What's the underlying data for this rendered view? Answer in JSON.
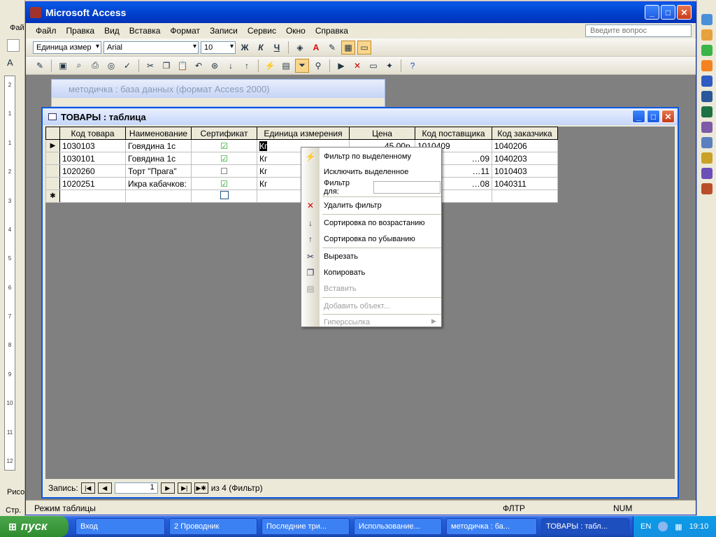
{
  "access": {
    "title": "Microsoft Access",
    "menu": [
      "Файл",
      "Правка",
      "Вид",
      "Вставка",
      "Формат",
      "Записи",
      "Сервис",
      "Окно",
      "Справка"
    ],
    "ask_placeholder": "Введите вопрос",
    "field_combo": "Единица измер",
    "font_combo": "Arial",
    "size_combo": "10"
  },
  "db_window": {
    "title": "методичка : база данных (формат Access 2000)"
  },
  "table_window": {
    "title": "ТОВАРЫ : таблица",
    "columns": [
      "Код товара",
      "Наименование",
      "Сертификат",
      "Единица измерения",
      "Цена",
      "Код поставщика",
      "Код заказчика"
    ],
    "rows": [
      [
        "1030103",
        "Говядина 1с",
        "☑",
        "Кг",
        "45,00р.",
        "1010409",
        "1040206"
      ],
      [
        "1030101",
        "Говядина 1с",
        "☑",
        "Кг",
        "",
        "…09",
        "1040203"
      ],
      [
        "1020260",
        "Торт \"Прага\"",
        "☐",
        "Кг",
        "",
        "…11",
        "1010403"
      ],
      [
        "1020251",
        "Икра кабачков:",
        "☑",
        "Кг",
        "",
        "…08",
        "1040311"
      ]
    ],
    "record_label": "Запись:",
    "record_value": "1",
    "record_total": "из  4 (Фильтр)"
  },
  "status": {
    "mode": "Режим таблицы",
    "filter": "ФЛТР",
    "num": "NUM"
  },
  "context_menu": {
    "filter_selection": "Фильтр по выделенному",
    "exclude_selection": "Исключить выделенное",
    "filter_for": "Фильтр для:",
    "remove_filter": "Удалить фильтр",
    "sort_asc": "Сортировка по возрастанию",
    "sort_desc": "Сортировка по убыванию",
    "cut": "Вырезать",
    "copy": "Копировать",
    "paste": "Вставить",
    "insert_object": "Добавить объект...",
    "hyperlink": "Гиперссылка"
  },
  "word_bg": {
    "menu_file": "Фай",
    "drawing": "Рисо",
    "page": "Стр."
  },
  "taskbar": {
    "start": "пуск",
    "tasks": [
      "Вход",
      "2 Проводник",
      "Последние три...",
      "Использование...",
      "методичка : ба...",
      "ТОВАРЫ : табл..."
    ],
    "lang": "EN",
    "clock": "19:10"
  }
}
